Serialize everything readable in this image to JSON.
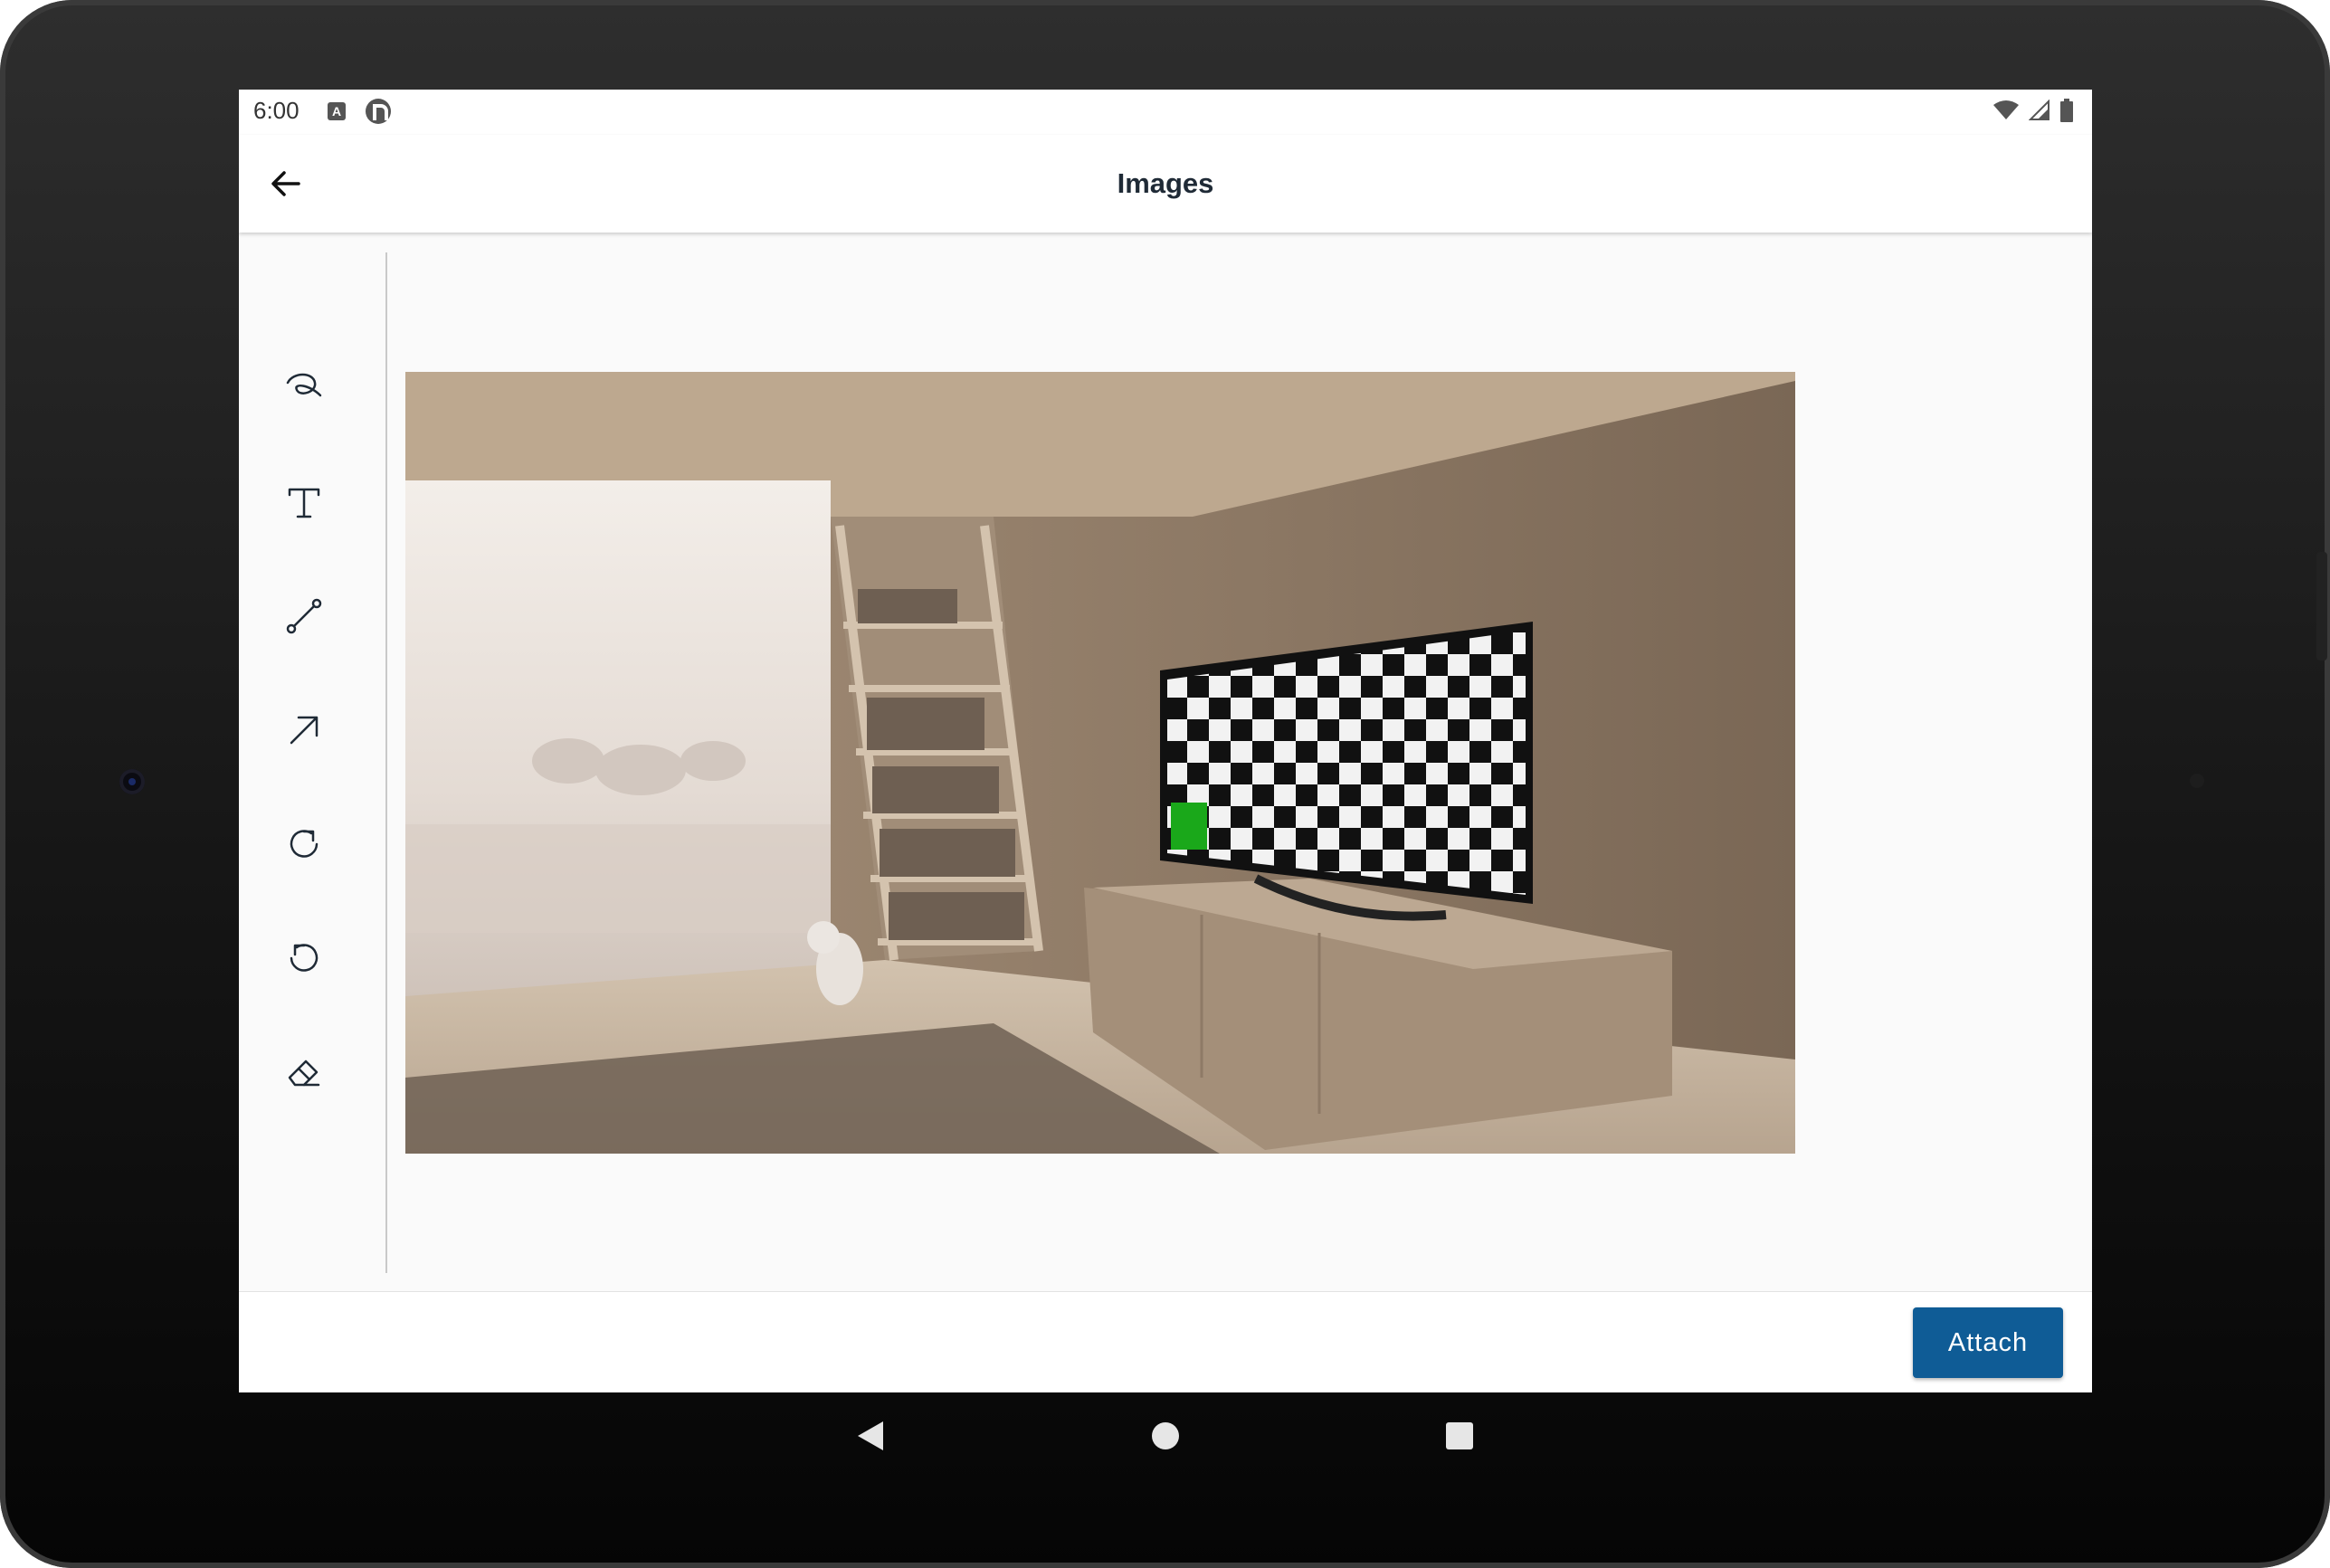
{
  "status_bar": {
    "time": "6:00",
    "left_icons": [
      "a-icon",
      "p-icon"
    ],
    "right_icons": [
      "wifi-icon",
      "signal-icon",
      "battery-icon"
    ]
  },
  "app_bar": {
    "title": "Images",
    "back_icon": "arrow-left-icon"
  },
  "tools": [
    {
      "name": "freehand-draw",
      "icon": "scribble-icon"
    },
    {
      "name": "text",
      "icon": "text-icon"
    },
    {
      "name": "line",
      "icon": "line-icon"
    },
    {
      "name": "arrow",
      "icon": "arrow-icon"
    },
    {
      "name": "redo",
      "icon": "redo-icon"
    },
    {
      "name": "undo",
      "icon": "undo-icon"
    },
    {
      "name": "eraser",
      "icon": "eraser-icon"
    }
  ],
  "image": {
    "description_icon": "photo-room-with-tv",
    "accent_green": "#1aa81a"
  },
  "bottom_bar": {
    "attach_label": "Attach"
  },
  "colors": {
    "primary": "#0f5c96",
    "title": "#1f2a36",
    "icon": "#1f2a36"
  },
  "nav_bar": {
    "buttons": [
      "back-triangle-icon",
      "home-circle-icon",
      "recents-square-icon"
    ]
  }
}
